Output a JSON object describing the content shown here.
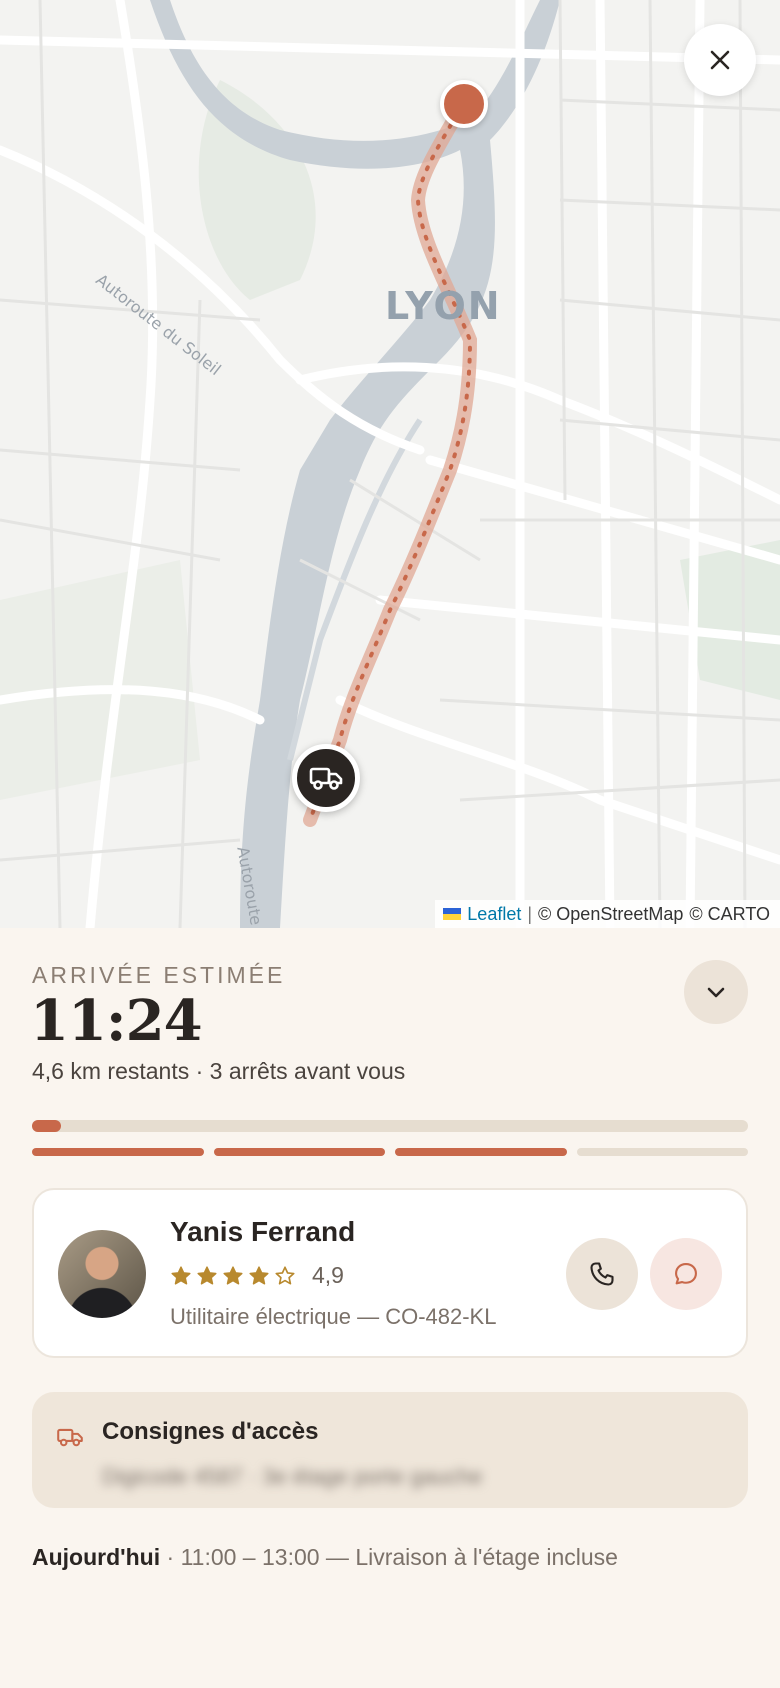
{
  "map": {
    "city_label": "LYON",
    "road_labels": [
      "Autoroute du Soleil",
      "Autoroute"
    ],
    "attribution": {
      "leaflet": "Leaflet",
      "separator": "|",
      "osm": "© OpenStreetMap",
      "carto": "© CARTO"
    },
    "close_icon": "close-icon",
    "destination_marker_color": "#c8684a",
    "vehicle_marker_icon": "truck-icon"
  },
  "eta": {
    "label": "ARRIVÉE ESTIMÉE",
    "time": "11:24",
    "subtitle": "4,6 km restants · 3 arrêts avant vous"
  },
  "progress": {
    "fraction": 0.04,
    "segments_total": 4,
    "segments_done": 3
  },
  "driver": {
    "name": "Yanis Ferrand",
    "rating": 4.9,
    "rating_text": "4,9",
    "stars_filled": 4,
    "stars_total": 5,
    "vehicle": "Utilitaire électrique — CO-482-KL"
  },
  "access": {
    "title": "Consignes d'accès",
    "text": "Digicode 4587 · 3e étage porte gauche"
  },
  "delivery": {
    "day": "Aujourd'hui",
    "separator": " · ",
    "details": "11:00 – 13:00 — Livraison à l'étage incluse"
  },
  "colors": {
    "accent": "#c8684a",
    "background": "#faf5ef",
    "star": "#b8892e"
  }
}
